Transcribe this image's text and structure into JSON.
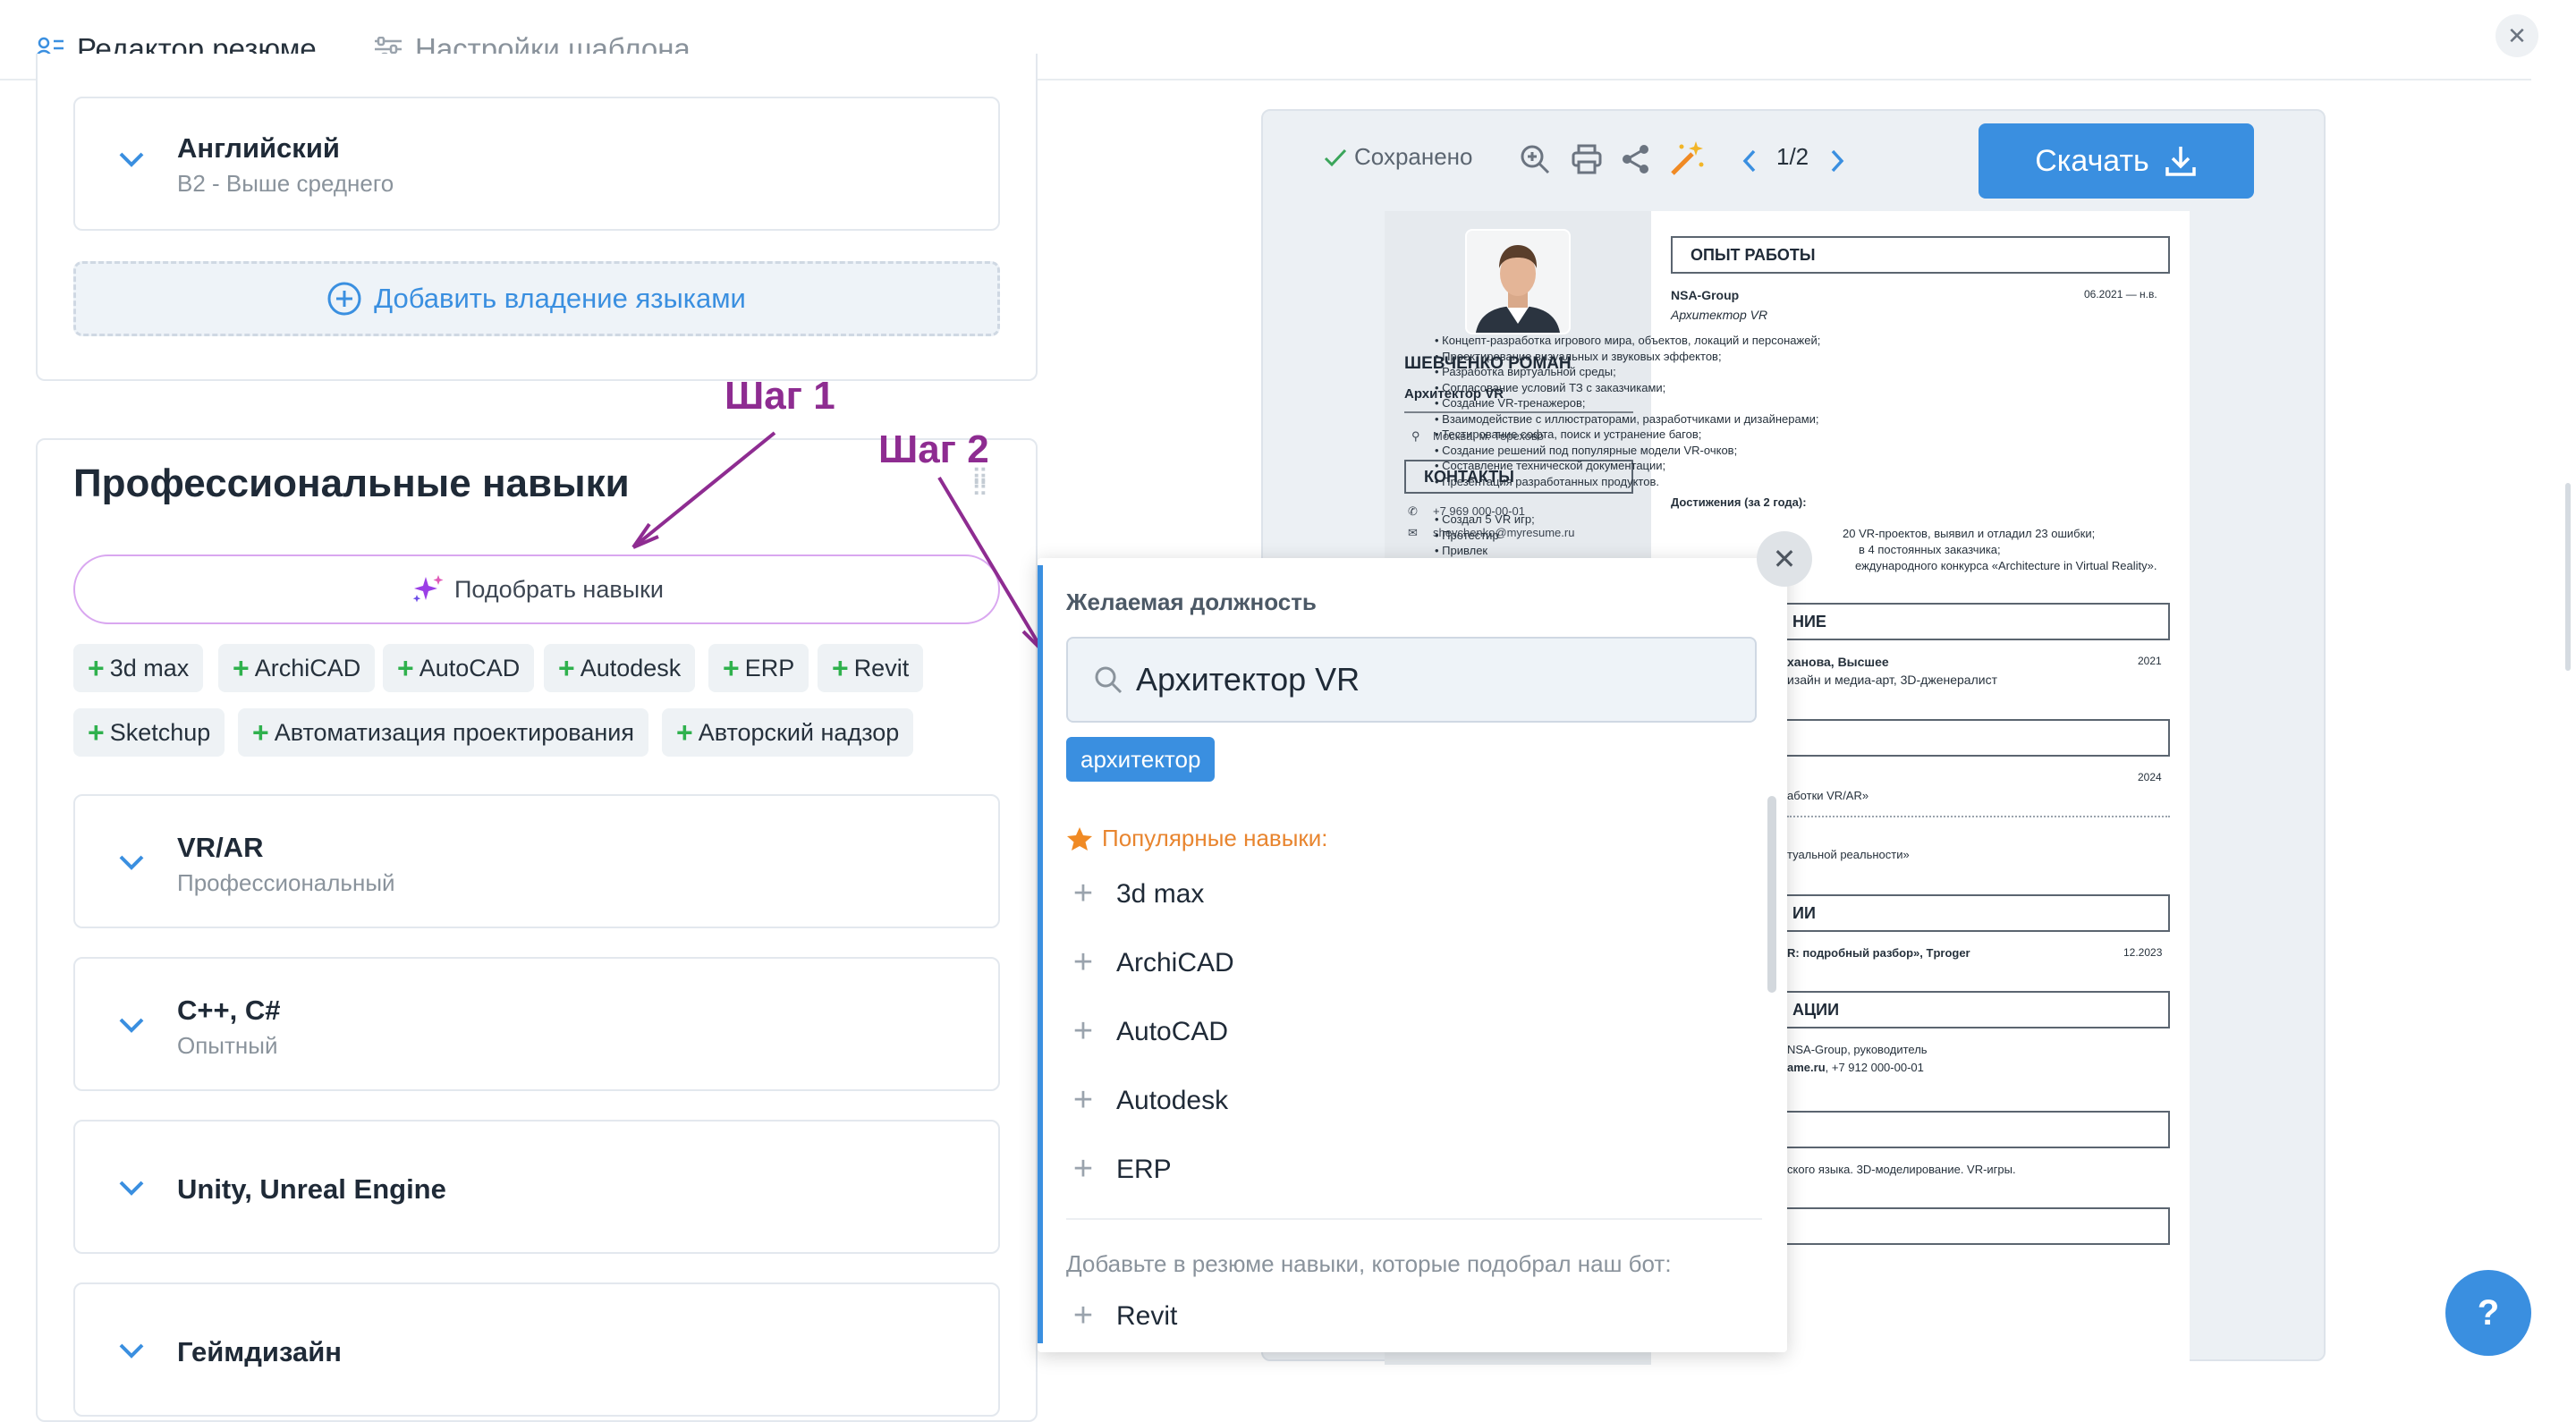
{
  "tabs": {
    "editor": "Редактор резюме",
    "template": "Настройки шаблона"
  },
  "languages": {
    "card": {
      "title": "Английский",
      "level": "B2 - Выше среднего"
    },
    "add_label": "Добавить владение языками"
  },
  "skills": {
    "section_title": "Профессиональные навыки",
    "pick_label": "Подобрать навыки",
    "chips": [
      "3d max",
      "ArchiCAD",
      "AutoCAD",
      "Autodesk",
      "ERP",
      "Revit",
      "Sketchup",
      "Автоматизация проектирования",
      "Авторский надзор"
    ],
    "items": [
      {
        "title": "VR/AR",
        "level": "Профессиональный"
      },
      {
        "title": "C++, C#",
        "level": "Опытный"
      },
      {
        "title": "Unity, Unreal Engine",
        "level": ""
      },
      {
        "title": "Геймдизайн",
        "level": ""
      }
    ]
  },
  "annotations": {
    "step1": "Шаг 1",
    "step2": "Шаг 2"
  },
  "preview_toolbar": {
    "saved": "Сохранено",
    "page": "1/2",
    "download": "Скачать"
  },
  "resume": {
    "name": "ШЕВЧЕНКО РОМАН",
    "role": "Архитектор VR",
    "location": "Москва, м. Терехово",
    "contacts_title": "КОНТАКТЫ",
    "phone": "+7 969 000-00-01",
    "email": "shevchenko@myresume.ru",
    "experience_title": "ОПЫТ РАБОТЫ",
    "company": "NSA-Group",
    "period": "06.2021 — н.в.",
    "job_role": "Архитектор VR",
    "duties": [
      "Концепт-разработка игрового мира, объектов, локаций и персонажей;",
      "Проектирование визуальных и звуковых эффектов;",
      "Разработка виртуальной среды;",
      "Согласование условий ТЗ с заказчиками;",
      "Создание VR-тренажеров;",
      "Взаимодействие с иллюстраторами, разработчиками и дизайнерами;",
      "Тестирование софта, поиск и устранение багов;",
      "Создание решений под популярные модели VR-очков;",
      "Составление технической документации;",
      "Презентация разработанных продуктов."
    ],
    "achievements_title": "Достижения (за 2 года):",
    "achievements": [
      "Создал 5 VR игр;",
      "Протестир",
      "Привлек"
    ],
    "ach_tail": [
      "20 VR-проектов, выявил и отладил 23 ошибки;",
      "в 4 постоянных заказчика;",
      "еждународного конкурса «Architecture in Virtual Reality»."
    ],
    "edu_title": "НИЕ",
    "edu_uni": "ханова, Высшее",
    "edu_year": "2021",
    "edu_spec": "изайн и медиа-арт, 3D-дженералист",
    "course_year": "2024",
    "course_name": "аботки VR/AR»",
    "course2": "туальной реальности»",
    "pub_title": "ИИ",
    "pub_text": "R: подробный разбор», Tproger",
    "pub_date": "12.2023",
    "rec_title": "АЦИИ",
    "rec_text": "NSA-Group, руководитель",
    "rec_contact_bold": "ame.ru",
    "rec_contact": ", +7 912 000-00-01",
    "about_text": "ского языка. 3D-моделирование. VR-игры."
  },
  "popup": {
    "label": "Желаемая должность",
    "input_value": "Архитектор VR",
    "tag": "архитектор",
    "popular_label": "Популярные навыки:",
    "popular": [
      "3d max",
      "ArchiCAD",
      "AutoCAD",
      "Autodesk",
      "ERP"
    ],
    "bot_note": "Добавьте в резюме навыки, которые подобрал наш бот:",
    "bot_items": [
      "Revit"
    ]
  },
  "help": {
    "label": "?"
  },
  "colors": {
    "accent": "#3a8fe0",
    "step": "#8e2c91",
    "plus": "#2fb14d",
    "popular": "#e8852f"
  }
}
